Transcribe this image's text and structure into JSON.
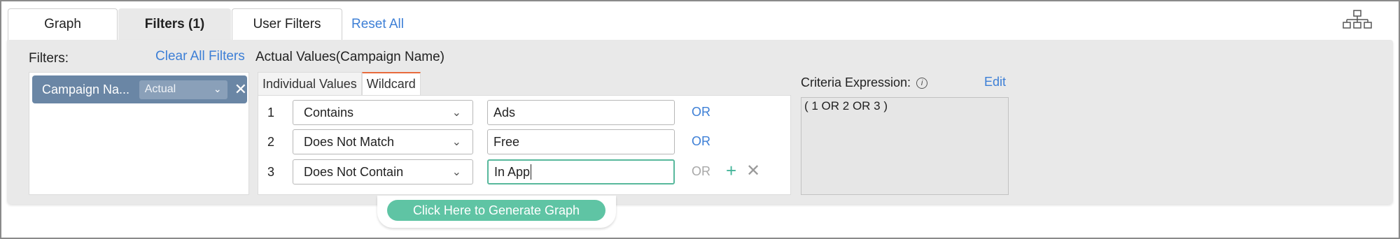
{
  "tabs": {
    "graph": "Graph",
    "filters": "Filters (1)",
    "user_filters": "User Filters",
    "reset_all": "Reset All"
  },
  "icons": {
    "hierarchy": "hierarchy-icon",
    "chevron": "chevron-down-icon",
    "close": "close-icon",
    "plus": "plus-icon",
    "info": "info-icon"
  },
  "filters_panel": {
    "label": "Filters:",
    "clear_all": "Clear All Filters",
    "chip": {
      "label": "Campaign Na...",
      "aggregation": "Actual"
    }
  },
  "values_panel": {
    "title": "Actual Values(Campaign Name)",
    "subtabs": [
      "Individual Values",
      "Wildcard"
    ],
    "rows": [
      {
        "num": "1",
        "operator": "Contains",
        "value": "Ads",
        "connector": "OR"
      },
      {
        "num": "2",
        "operator": "Does Not Match",
        "value": "Free",
        "connector": "OR"
      },
      {
        "num": "3",
        "operator": "Does Not Contain",
        "value": "In App",
        "connector": "OR"
      }
    ]
  },
  "criteria": {
    "label": "Criteria Expression:",
    "edit": "Edit",
    "expression": "( 1 OR 2 OR 3 )"
  },
  "generate_button": "Click Here to Generate Graph",
  "colors": {
    "accent_blue": "#3d7fd6",
    "chip_bg": "#6a86a5",
    "generate_green": "#5fc4a4",
    "active_tab_border": "#e86b3c"
  }
}
